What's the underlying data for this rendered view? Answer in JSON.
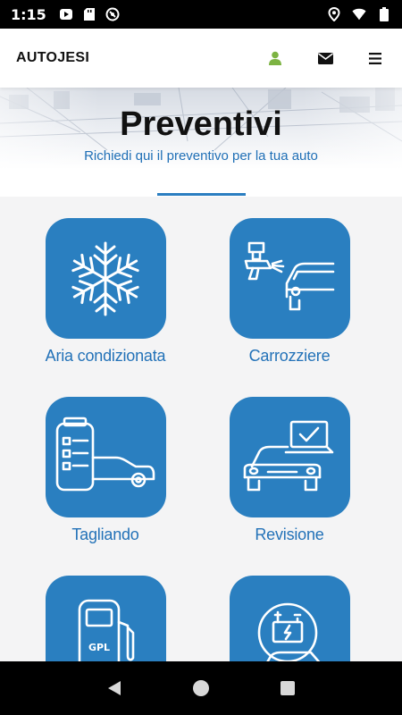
{
  "status_bar": {
    "time": "1:15",
    "left_icons": [
      "play-store-icon",
      "sd-card-icon",
      "no-disturb-icon"
    ],
    "right_icons": [
      "location-icon",
      "wifi-icon",
      "battery-icon"
    ]
  },
  "app_bar": {
    "title": "AUTOJESI",
    "actions": [
      "user-icon",
      "mail-icon",
      "menu-icon"
    ],
    "user_icon_color": "#7cb342"
  },
  "hero": {
    "title": "Preventivi",
    "subtitle": "Richiedi qui il preventivo per la tua auto"
  },
  "services": [
    {
      "label": "Aria condizionata",
      "icon": "snowflake-icon"
    },
    {
      "label": "Carrozziere",
      "icon": "spray-gun-car-icon"
    },
    {
      "label": "Tagliando",
      "icon": "checklist-car-icon"
    },
    {
      "label": "Revisione",
      "icon": "laptop-car-icon"
    },
    {
      "label": "",
      "icon": "gpl-pump-icon",
      "pump_text": "GPL"
    },
    {
      "label": "",
      "icon": "battery-car-icon"
    }
  ],
  "colors": {
    "accent": "#2a7fc0",
    "label": "#2372b8",
    "background": "#f4f4f5"
  },
  "nav_bar": [
    "back-icon",
    "home-icon",
    "recents-icon"
  ]
}
